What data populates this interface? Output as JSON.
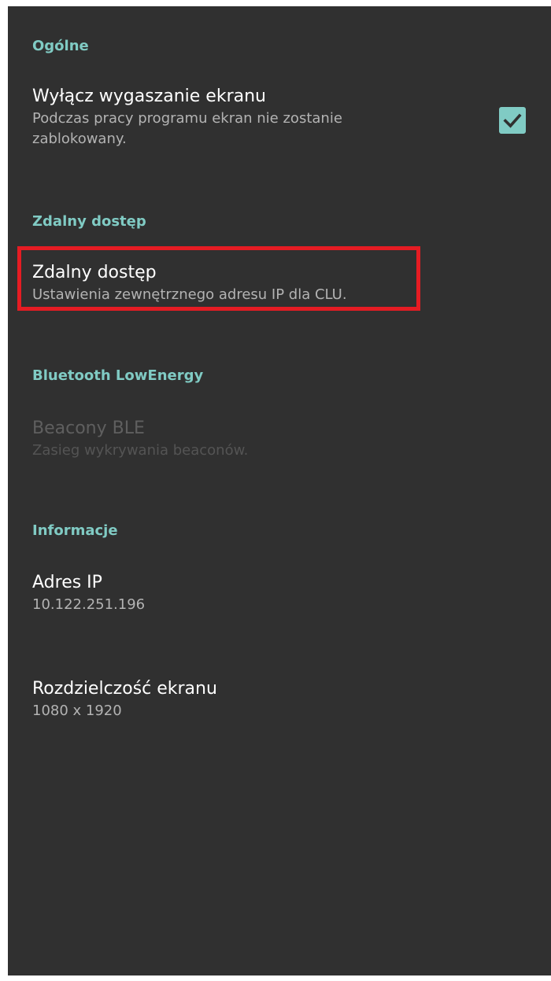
{
  "colors": {
    "background": "#303030",
    "accent": "#80cbc4",
    "highlight": "#e51c23"
  },
  "sections": {
    "general": {
      "header": "Ogólne",
      "screen_timeout": {
        "title": "Wyłącz wygaszanie ekranu",
        "summary": "Podczas pracy programu ekran nie zostanie zablokowany.",
        "checked": true,
        "icon": "check-icon"
      }
    },
    "remote": {
      "header": "Zdalny dostęp",
      "remote_access": {
        "title": "Zdalny dostęp",
        "summary": "Ustawienia zewnętrznego adresu IP dla CLU.",
        "highlighted": true
      }
    },
    "bluetooth": {
      "header": "Bluetooth LowEnergy",
      "beacons": {
        "title": "Beacony BLE",
        "summary": "Zasieg wykrywania beaconów.",
        "enabled": false
      }
    },
    "info": {
      "header": "Informacje",
      "ip_address": {
        "title": "Adres IP",
        "value": "10.122.251.196"
      },
      "resolution": {
        "title": "Rozdzielczość ekranu",
        "value": "1080 x 1920"
      }
    }
  }
}
